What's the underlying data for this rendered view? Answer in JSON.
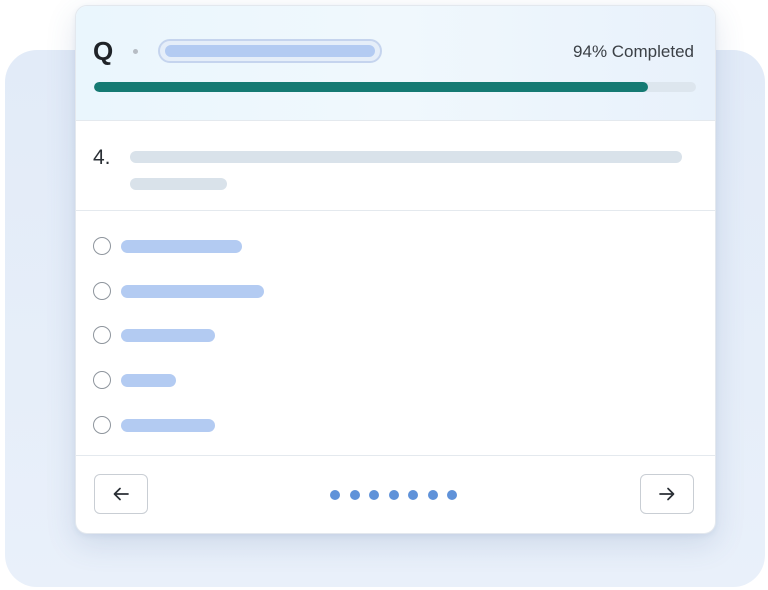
{
  "header": {
    "quiz_letter": "Q",
    "progress_text": "94% Completed",
    "progress_fraction": 0.92
  },
  "question": {
    "number": "4."
  },
  "options": [
    {
      "id": 1,
      "placeholder_fraction": 0.22
    },
    {
      "id": 2,
      "placeholder_fraction": 0.26
    },
    {
      "id": 3,
      "placeholder_fraction": 0.17
    },
    {
      "id": 4,
      "placeholder_fraction": 0.1
    },
    {
      "id": 5,
      "placeholder_fraction": 0.17
    }
  ],
  "footer": {
    "prev_icon": "arrow-left-icon",
    "next_icon": "arrow-right-icon",
    "page_count": 7
  },
  "colors": {
    "progress_fill": "#157a73",
    "placeholder_blue": "#b3cbf2",
    "pager_dot": "#5f92d9"
  }
}
